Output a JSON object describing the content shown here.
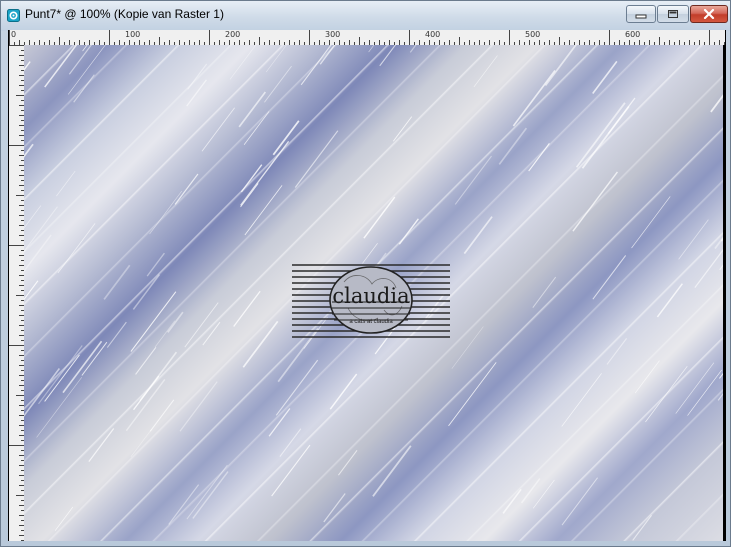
{
  "window": {
    "title": "Punt7* @ 100% (Kopie van Raster 1)",
    "controls": [
      {
        "name": "minimize",
        "icon": "minimize-icon"
      },
      {
        "name": "maximize",
        "icon": "maximize-icon"
      },
      {
        "name": "close",
        "icon": "close-icon"
      }
    ]
  },
  "ruler": {
    "top_labels": [
      "0",
      "100",
      "200",
      "300",
      "400",
      "500",
      "600"
    ]
  },
  "canvas": {
    "zoom": "100%",
    "layer": "Kopie van Raster 1",
    "colors": {
      "blue": "#8c95bf",
      "silver": "#e2e2e6",
      "gray": "#c7c9d6"
    },
    "logo": {
      "word": "claudia",
      "tagline": "a cats at claudia"
    }
  }
}
